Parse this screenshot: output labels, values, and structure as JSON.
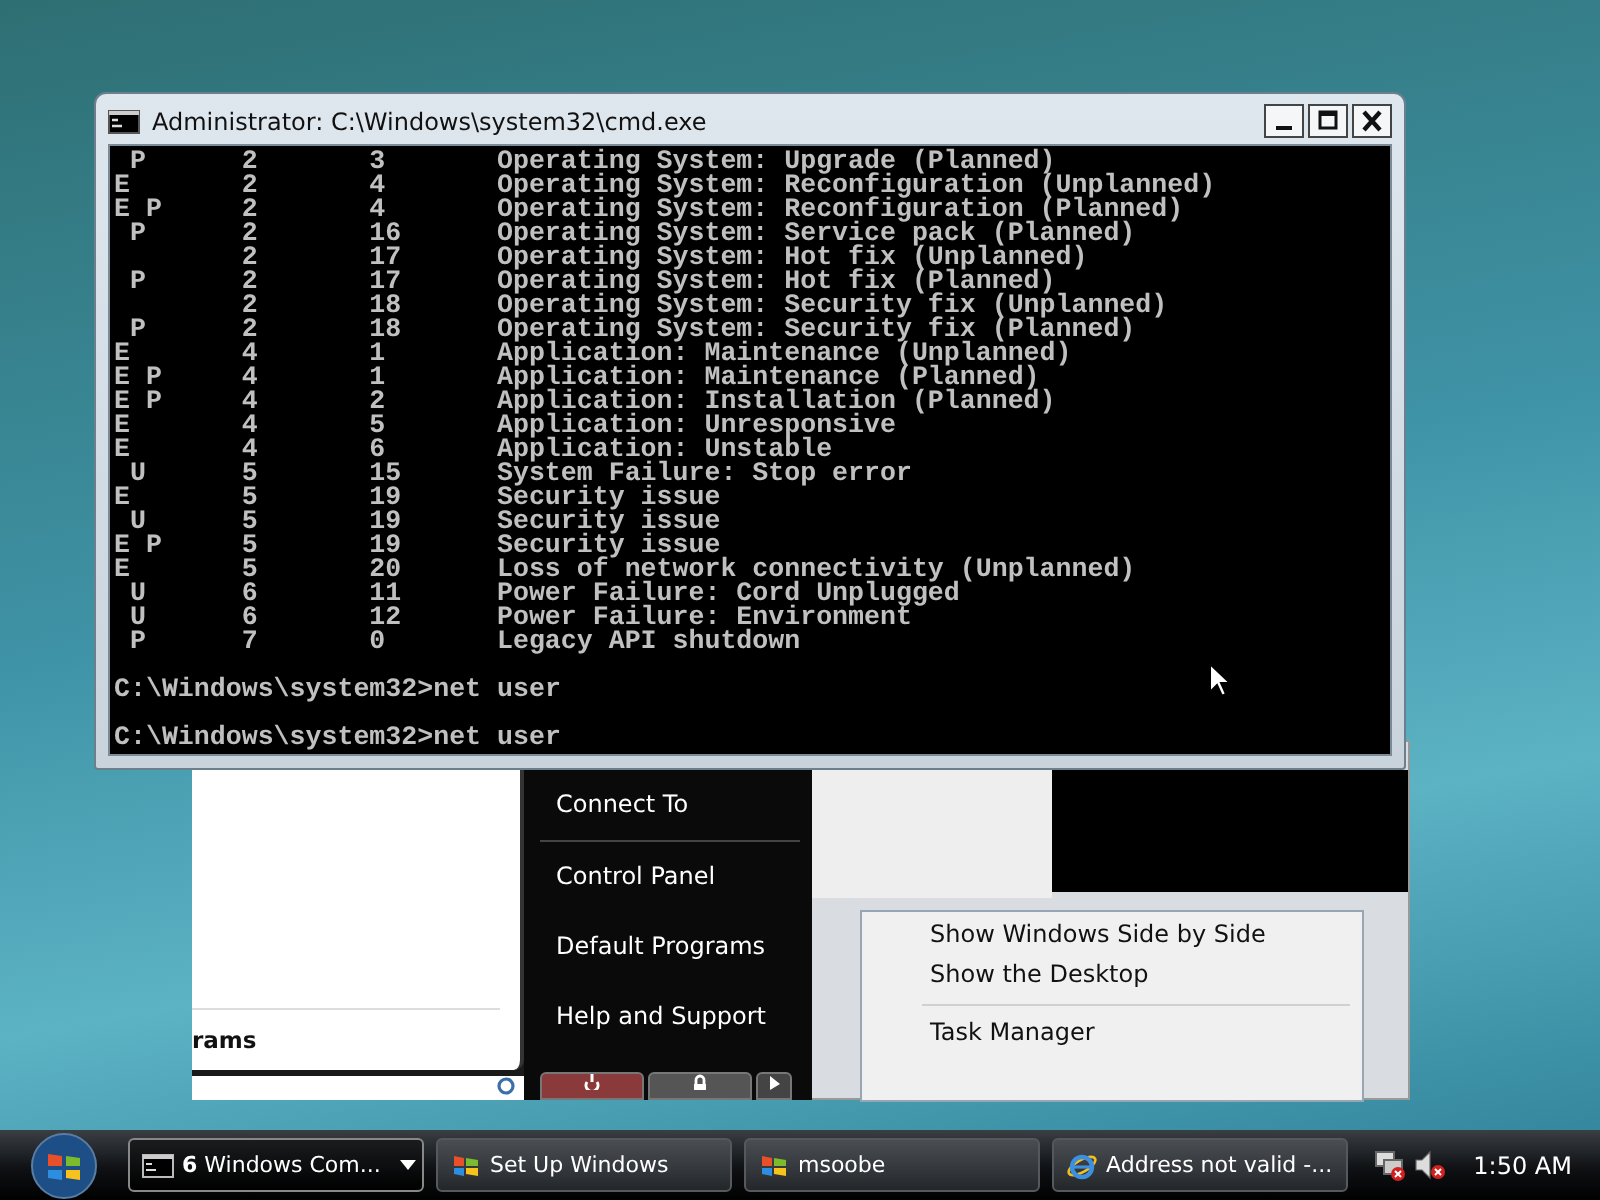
{
  "console_window": {
    "title": "Administrator: C:\\Windows\\system32\\cmd.exe",
    "lines": [
      {
        "flags": " P",
        "major": "2",
        "minor": "3",
        "reason": "Operating System: Upgrade (Planned)"
      },
      {
        "flags": "E",
        "major": "2",
        "minor": "4",
        "reason": "Operating System: Reconfiguration (Unplanned)"
      },
      {
        "flags": "E P",
        "major": "2",
        "minor": "4",
        "reason": "Operating System: Reconfiguration (Planned)"
      },
      {
        "flags": " P",
        "major": "2",
        "minor": "16",
        "reason": "Operating System: Service pack (Planned)"
      },
      {
        "major": "2",
        "minor": "17",
        "reason": "Operating System: Hot fix (Unplanned)"
      },
      {
        "flags": " P",
        "major": "2",
        "minor": "17",
        "reason": "Operating System: Hot fix (Planned)"
      },
      {
        "major": "2",
        "minor": "18",
        "reason": "Operating System: Security fix (Unplanned)"
      },
      {
        "flags": " P",
        "major": "2",
        "minor": "18",
        "reason": "Operating System: Security fix (Planned)"
      },
      {
        "flags": "E",
        "major": "4",
        "minor": "1",
        "reason": "Application: Maintenance (Unplanned)"
      },
      {
        "flags": "E P",
        "major": "4",
        "minor": "1",
        "reason": "Application: Maintenance (Planned)"
      },
      {
        "flags": "E P",
        "major": "4",
        "minor": "2",
        "reason": "Application: Installation (Planned)"
      },
      {
        "flags": "E",
        "major": "4",
        "minor": "5",
        "reason": "Application: Unresponsive"
      },
      {
        "flags": "E",
        "major": "4",
        "minor": "6",
        "reason": "Application: Unstable"
      },
      {
        "flags": " U",
        "major": "5",
        "minor": "15",
        "reason": "System Failure: Stop error"
      },
      {
        "flags": "E",
        "major": "5",
        "minor": "19",
        "reason": "Security issue"
      },
      {
        "flags": " U",
        "major": "5",
        "minor": "19",
        "reason": "Security issue"
      },
      {
        "flags": "E P",
        "major": "5",
        "minor": "19",
        "reason": "Security issue"
      },
      {
        "flags": "E",
        "major": "5",
        "minor": "20",
        "reason": "Loss of network connectivity (Unplanned)"
      },
      {
        "flags": " U",
        "major": "6",
        "minor": "11",
        "reason": "Power Failure: Cord Unplugged"
      },
      {
        "flags": " U",
        "major": "6",
        "minor": "12",
        "reason": "Power Failure: Environment"
      },
      {
        "flags": " P",
        "major": "7",
        "minor": "0",
        "reason": "Legacy API shutdown"
      }
    ],
    "prompts": [
      "C:\\Windows\\system32>net user",
      "C:\\Windows\\system32>net user"
    ]
  },
  "start_menu": {
    "programs_label": "rams",
    "right_items": [
      "Connect To",
      "Control Panel",
      "Default Programs",
      "Help and Support"
    ]
  },
  "context_menu": {
    "items": [
      {
        "kind": "item",
        "label": "Show Windows Side by Side"
      },
      {
        "kind": "item",
        "label": "Show the Desktop"
      },
      {
        "kind": "separator"
      },
      {
        "kind": "item",
        "label": "Task Manager"
      }
    ]
  },
  "taskbar": {
    "buttons": [
      {
        "kind": "console",
        "label": "**6** Windows Com...",
        "selected": true,
        "has_menu": true
      },
      {
        "kind": "setup",
        "label": "Set Up Windows",
        "selected": false,
        "has_menu": false
      },
      {
        "kind": "setup",
        "label": "msoobe",
        "selected": false,
        "has_menu": false
      },
      {
        "kind": "browser",
        "label": "Address not valid -...",
        "selected": false,
        "has_menu": false
      }
    ],
    "clock": "1:50 AM"
  }
}
